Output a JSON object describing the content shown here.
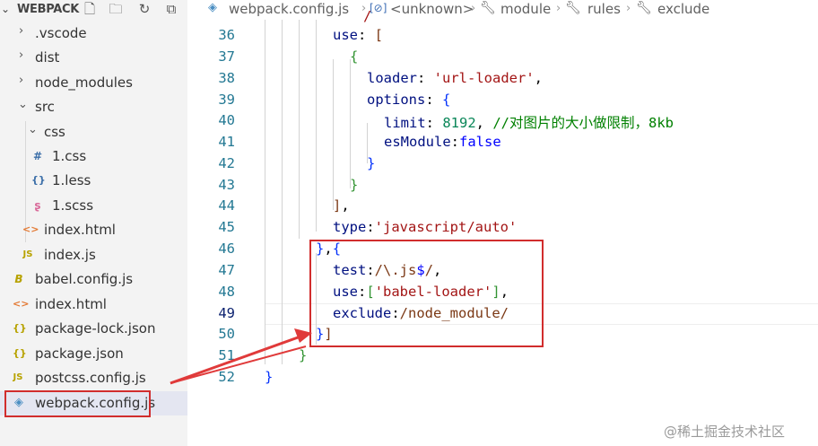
{
  "explorer": {
    "title": "WEBPACK",
    "actions": [
      "new-file-icon",
      "new-folder-icon",
      "refresh-icon",
      "collapse-all-icon"
    ],
    "items": [
      {
        "label": ".vscode",
        "type": "folder",
        "expanded": false
      },
      {
        "label": "dist",
        "type": "folder",
        "expanded": false
      },
      {
        "label": "node_modules",
        "type": "folder",
        "expanded": false
      },
      {
        "label": "src",
        "type": "folder",
        "expanded": true
      },
      {
        "label": "css",
        "type": "folder",
        "expanded": true
      },
      {
        "label": "1.css",
        "type": "css",
        "icon": "#"
      },
      {
        "label": "1.less",
        "type": "less",
        "icon": "{}"
      },
      {
        "label": "1.scss",
        "type": "scss",
        "icon": "ʂ"
      },
      {
        "label": "index.html",
        "type": "html",
        "icon": "<>"
      },
      {
        "label": "index.js",
        "type": "js",
        "icon": "JS"
      },
      {
        "label": "babel.config.js",
        "type": "babel",
        "icon": "B"
      },
      {
        "label": "index.html",
        "type": "html",
        "icon": "<>"
      },
      {
        "label": "package-lock.json",
        "type": "json",
        "icon": "{}"
      },
      {
        "label": "package.json",
        "type": "json",
        "icon": "{}"
      },
      {
        "label": "postcss.config.js",
        "type": "js",
        "icon": "JS"
      },
      {
        "label": "webpack.config.js",
        "type": "webpack",
        "icon": "◈",
        "selected": true
      }
    ]
  },
  "breadcrumb": {
    "file": "webpack.config.js",
    "items": [
      "<unknown>",
      "module",
      "rules",
      "exclude"
    ]
  },
  "editor": {
    "active_line": 49,
    "lines": [
      {
        "n": 36,
        "text": "use: ["
      },
      {
        "n": 37,
        "text": "{"
      },
      {
        "n": 38,
        "text": "loader: 'url-loader',"
      },
      {
        "n": 39,
        "text": "options: {"
      },
      {
        "n": 40,
        "text": "limit: 8192, //对图片的大小做限制，8kb"
      },
      {
        "n": 41,
        "text": "esModule:false"
      },
      {
        "n": 42,
        "text": "}"
      },
      {
        "n": 43,
        "text": "}"
      },
      {
        "n": 44,
        "text": "],"
      },
      {
        "n": 45,
        "text": "type:'javascript/auto'"
      },
      {
        "n": 46,
        "text": "},{"
      },
      {
        "n": 47,
        "text": "test:/\\.js$/,"
      },
      {
        "n": 48,
        "text": "use:['babel-loader'],"
      },
      {
        "n": 49,
        "text": "exclude:/node_module/"
      },
      {
        "n": 50,
        "text": "}]"
      },
      {
        "n": 51,
        "text": "}"
      },
      {
        "n": 52,
        "text": "}"
      }
    ]
  },
  "tokens": {
    "l36_key": "use",
    "l36_punct": ": ",
    "l36_br": "[",
    "l37_br": "{",
    "l38_key": "loader",
    "l38_punct": ": ",
    "l38_str": "'url-loader'",
    "l38_end": ",",
    "l39_key": "options",
    "l39_punct": ": ",
    "l39_br": "{",
    "l40_key": "limit",
    "l40_punct": ": ",
    "l40_num": "8192",
    "l40_comma": ", ",
    "l40_cmt": "//对图片的大小做限制，8kb",
    "l41_key": "esModule",
    "l41_punct": ":",
    "l41_kw": "false",
    "l42_br": "}",
    "l43_br": "}",
    "l44_br": "]",
    "l44_end": ",",
    "l45_key": "type",
    "l45_punct": ":",
    "l45_str": "'javascript/auto'",
    "l46_br1": "}",
    "l46_comma": ",",
    "l46_br2": "{",
    "l47_key": "test",
    "l47_punct": ":",
    "l47_re1": "/\\.js",
    "l47_re2": "$",
    "l47_re3": "/",
    "l47_end": ",",
    "l48_key": "use",
    "l48_punct": ":",
    "l48_br1": "[",
    "l48_str": "'babel-loader'",
    "l48_br2": "]",
    "l48_end": ",",
    "l49_key": "exclude",
    "l49_punct": ":",
    "l49_re": "/node_module/",
    "l50_br1": "}",
    "l50_br2": "]",
    "l51_br": "}",
    "l52_br": "}",
    "top_partial": "/ "
  },
  "watermark": "@稀土掘金技术社区",
  "colors": {
    "sidebar_bg": "#f3f3f3",
    "selected_bg": "#e4e6f1",
    "line_number": "#237893",
    "string": "#a31515",
    "number": "#098658",
    "comment": "#008000",
    "keyword": "#0000ff",
    "annotation_red": "#d12d2d"
  }
}
